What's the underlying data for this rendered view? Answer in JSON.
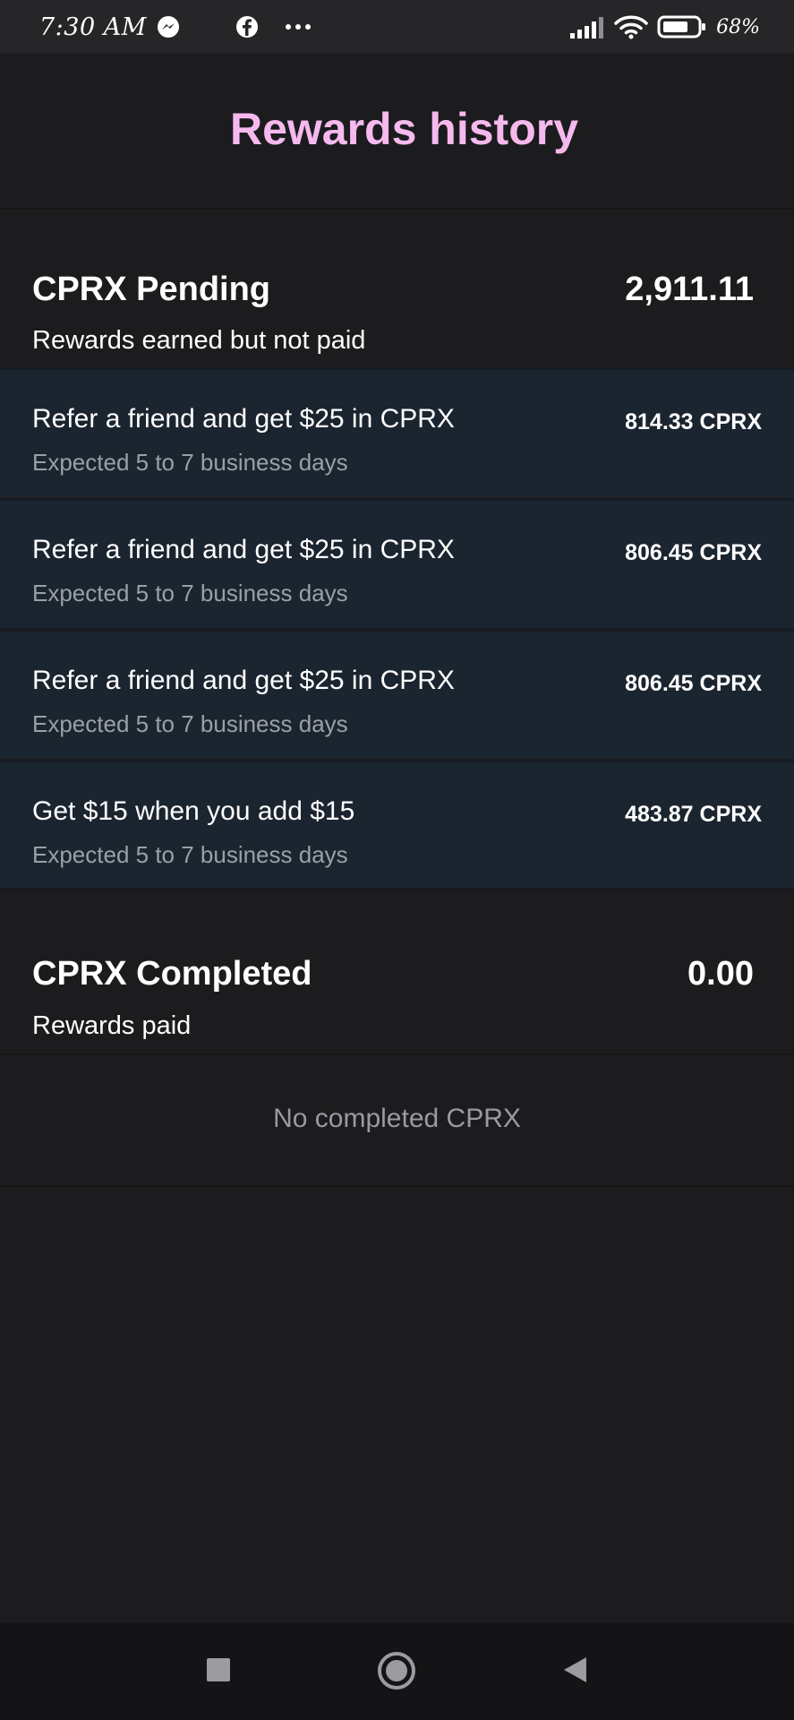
{
  "status_bar": {
    "time": "7:30 AM",
    "battery": "68%",
    "icons": [
      "messenger-icon",
      "facebook-icon",
      "more-dots-icon",
      "signal-icon",
      "wifi-icon",
      "battery-icon"
    ]
  },
  "header": {
    "title": "Rewards history",
    "title_color": "#f6b9ee"
  },
  "pending": {
    "title": "CPRX Pending",
    "total": "2,911.11",
    "subtitle": "Rewards earned but not paid",
    "items": [
      {
        "title": "Refer a friend and get $25 in CPRX",
        "subtitle": "Expected 5 to 7 business days",
        "amount": "814.33 CPRX"
      },
      {
        "title": "Refer a friend and get $25 in CPRX",
        "subtitle": "Expected 5 to 7 business days",
        "amount": "806.45 CPRX"
      },
      {
        "title": "Refer a friend and get $25 in CPRX",
        "subtitle": "Expected 5 to 7 business days",
        "amount": "806.45 CPRX"
      },
      {
        "title": "Get $15 when you add $15",
        "subtitle": "Expected 5 to 7 business days",
        "amount": "483.87 CPRX"
      }
    ]
  },
  "completed": {
    "title": "CPRX Completed",
    "total": "0.00",
    "subtitle": "Rewards paid",
    "empty_text": "No completed CPRX"
  },
  "nav_bar": {
    "icons": [
      "recents-square-icon",
      "home-circle-icon",
      "back-triangle-icon"
    ]
  }
}
